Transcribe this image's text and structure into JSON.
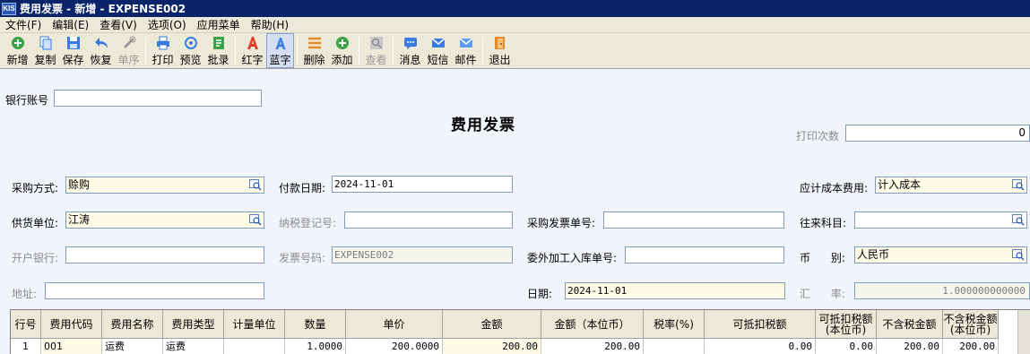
{
  "window": {
    "title": "费用发票 - 新增 - EXPENSE002",
    "logo_text": "KIS"
  },
  "menu": [
    "文件(F)",
    "编辑(E)",
    "查看(V)",
    "选项(O)",
    "应用菜单",
    "帮助(H)"
  ],
  "toolbar": {
    "new": "新增",
    "copy": "复制",
    "save": "保存",
    "restore": "恢复",
    "sequence": "单序",
    "print": "打印",
    "preview": "预览",
    "batch_record": "批录",
    "red_word": "红字",
    "blue_word": "蓝字",
    "delete": "删除",
    "add": "添加",
    "view": "查看",
    "message": "消息",
    "sms": "短信",
    "email": "邮件",
    "exit": "退出"
  },
  "colors": {
    "titlebar": "#0a246a",
    "red_icon": "#e03c2c",
    "blue_icon": "#3a7be0",
    "green_icon": "#3aa24a",
    "orange_icon": "#e38b2a"
  },
  "form": {
    "title": "费用发票",
    "bank_account": {
      "label": "银行账号",
      "value": ""
    },
    "print_count": {
      "label": "打印次数",
      "value": "0"
    },
    "purchase_method": {
      "label": "采购方式:",
      "value": "赊购"
    },
    "payment_date": {
      "label": "付款日期:",
      "value": "2024-11-01"
    },
    "cost_expense": {
      "label": "应计成本费用:",
      "value": "计入成本"
    },
    "supplier": {
      "label": "供货单位:",
      "value": "江涛"
    },
    "tax_reg_no": {
      "label": "纳税登记号:",
      "value": ""
    },
    "purchase_invoice_no": {
      "label": "采购发票单号:",
      "value": ""
    },
    "account_subject": {
      "label": "往来科目:",
      "value": ""
    },
    "bank": {
      "label": "开户银行:",
      "value": ""
    },
    "invoice_no": {
      "label": "发票号码:",
      "value": "EXPENSE002"
    },
    "outsource_receipt_no": {
      "label": "委外加工入库单号:",
      "value": ""
    },
    "currency": {
      "label": "币      别:",
      "value": "人民币"
    },
    "address": {
      "label": "地址:",
      "value": ""
    },
    "date": {
      "label": "日期:",
      "value": "2024-11-01"
    },
    "exchange_rate": {
      "label": "汇      率:",
      "value": "1.000000000000"
    }
  },
  "grid": {
    "headers": [
      "行号",
      "费用代码",
      "费用名称",
      "费用类型",
      "计量单位",
      "数量",
      "单价",
      "金额",
      "金额（本位币）",
      "税率(%)",
      "可抵扣税额",
      "可抵扣税额(本位币)",
      "不含税金额",
      "不含税金额(本位币)"
    ],
    "rows": [
      [
        "1",
        "001",
        "运费",
        "运费",
        "",
        "1.0000",
        "200.0000",
        "200.00",
        "200.00",
        "",
        "0.00",
        "0.00",
        "200.00",
        "200.00"
      ]
    ]
  }
}
